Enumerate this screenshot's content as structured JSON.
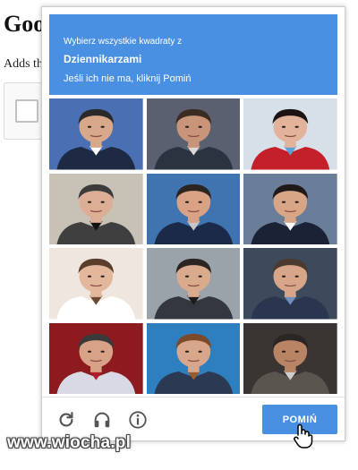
{
  "background": {
    "heading": "Goo",
    "text": "Adds th"
  },
  "captcha": {
    "header": {
      "instruction": "Wybierz wszystkie kwadraty z",
      "target": "Dziennikarzami",
      "hint": "Jeśli ich nie ma, kliknij Pomiń"
    },
    "skip_label": "POMIŃ",
    "tiles": [
      {
        "bg": "#4a6fb3",
        "skin": "#d7a88a",
        "hair": "#2a2a2a",
        "cloth": "#1e2a44",
        "accent": "#ffffff"
      },
      {
        "bg": "#5a6070",
        "skin": "#c9957a",
        "hair": "#3a2c22",
        "cloth": "#2b3340",
        "accent": "#d9d9d9"
      },
      {
        "bg": "#d7dfe8",
        "skin": "#e2b39a",
        "hair": "#1c1414",
        "cloth": "#c4202a",
        "accent": "#5aa0d8"
      },
      {
        "bg": "#c8c2b6",
        "skin": "#dcae95",
        "hair": "#3b3b3b",
        "cloth": "#3f3f3f",
        "accent": "#111111"
      },
      {
        "bg": "#3f74b0",
        "skin": "#d9a285",
        "hair": "#2c2420",
        "cloth": "#1b2a48",
        "accent": "#c7c7c7"
      },
      {
        "bg": "#6a7d99",
        "skin": "#d8a586",
        "hair": "#1f1a18",
        "cloth": "#1b2236",
        "accent": "#ffffff"
      },
      {
        "bg": "#efe7df",
        "skin": "#e3b79c",
        "hair": "#5a3e2b",
        "cloth": "#ffffff",
        "accent": "#6b4a35"
      },
      {
        "bg": "#9aa2aa",
        "skin": "#d9aa8c",
        "hair": "#2d2522",
        "cloth": "#333840",
        "accent": "#1a1a1a"
      },
      {
        "bg": "#3c4a5c",
        "skin": "#d7a689",
        "hair": "#4a3a30",
        "cloth": "#2a3550",
        "accent": "#6f90c0"
      },
      {
        "bg": "#8c1a1e",
        "skin": "#d7a286",
        "hair": "#3a3a3a",
        "cloth": "#d9d9e6",
        "accent": "#b01c2a"
      },
      {
        "bg": "#2e7fc0",
        "skin": "#d8a68a",
        "hair": "#7a4a2a",
        "cloth": "#2b3a52",
        "accent": "#9a5a2e"
      },
      {
        "bg": "#3a3432",
        "skin": "#b98466",
        "hair": "#2a2624",
        "cloth": "#5a554e",
        "accent": "#cfcfcf"
      }
    ]
  },
  "watermark": "www.wiocha.pl"
}
